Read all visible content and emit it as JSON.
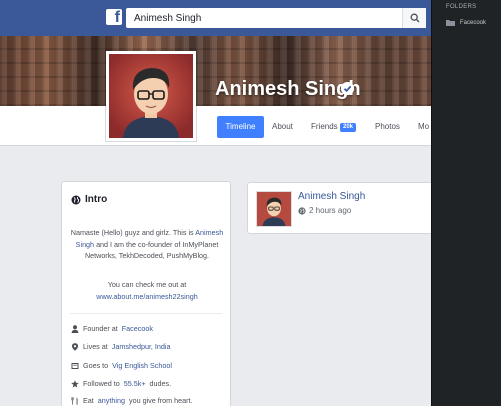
{
  "search": {
    "value": "Animesh Singh"
  },
  "profile": {
    "name": "Animesh Singh"
  },
  "tabs": [
    {
      "label": "Timeline"
    },
    {
      "label": "About"
    },
    {
      "label": "Friends",
      "badge": "20k"
    },
    {
      "label": "Photos"
    },
    {
      "label": "Mo"
    }
  ],
  "intro": {
    "title": "Intro",
    "bio_prefix": "Namaste (Hello) guyz and girlz. This is",
    "bio_name": "Animesh Singh",
    "bio_suffix": "and I am the co-founder of InMyPlanet Networks, TekhDecoded, PushMyBlog.",
    "website_prefix": "You can check me out at",
    "website_url": "www.about.me/animesh22singh",
    "rows": [
      {
        "icon": "person-icon",
        "text": "Founder at",
        "link": "Facecook"
      },
      {
        "icon": "location-pin-icon",
        "text": "Lives at",
        "link": "Jamshedpur, India"
      },
      {
        "icon": "school-icon",
        "text": "Goes to",
        "link": "Vig English School"
      },
      {
        "icon": "star-icon",
        "text": "Followed to",
        "link": "55.5k+",
        "tail": "dudes."
      },
      {
        "icon": "fork-knife-icon",
        "text": "Eat",
        "link": "anything",
        "tail": "you give from heart."
      }
    ]
  },
  "post": {
    "author": "Animesh Singh",
    "time": "2 hours ago"
  },
  "folders": {
    "title": "FOLDERS",
    "items": [
      {
        "label": "Facecook"
      }
    ]
  },
  "colors": {
    "brand": "#3b5998",
    "accent": "#4080ff",
    "link": "#385898",
    "page_bg": "#e9ebee",
    "panel_bg": "#1f2326"
  }
}
